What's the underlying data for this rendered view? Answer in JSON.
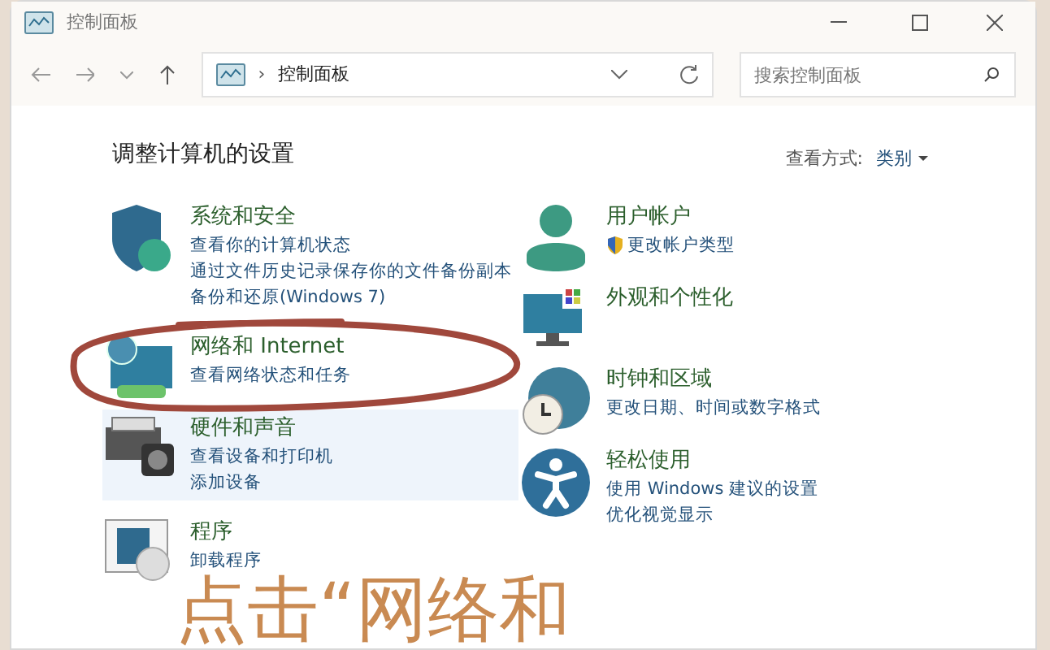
{
  "window": {
    "title": "控制面板"
  },
  "address_bar": {
    "separator": "›",
    "path": "控制面板"
  },
  "search": {
    "placeholder": "搜索控制面板"
  },
  "heading": "调整计算机的设置",
  "view_by": {
    "label": "查看方式:",
    "value": "类别"
  },
  "columns": [
    {
      "categories": [
        {
          "title": "系统和安全",
          "highlighted": false,
          "links": [
            {
              "text": "查看你的计算机状态",
              "shield": false
            },
            {
              "text": "通过文件历史记录保存你的文件备份副本",
              "shield": false
            },
            {
              "text": "备份和还原(Windows 7)",
              "shield": false
            }
          ]
        },
        {
          "title": "网络和 Internet",
          "highlighted": false,
          "links": [
            {
              "text": "查看网络状态和任务",
              "shield": false
            }
          ]
        },
        {
          "title": "硬件和声音",
          "highlighted": true,
          "links": [
            {
              "text": "查看设备和打印机",
              "shield": false
            },
            {
              "text": "添加设备",
              "shield": false
            }
          ]
        },
        {
          "title": "程序",
          "highlighted": false,
          "links": [
            {
              "text": "卸载程序",
              "shield": false
            }
          ]
        }
      ]
    },
    {
      "categories": [
        {
          "title": "用户帐户",
          "highlighted": false,
          "links": [
            {
              "text": "更改帐户类型",
              "shield": true
            }
          ]
        },
        {
          "title": "外观和个性化",
          "highlighted": false
        },
        {
          "title": "时钟和区域",
          "highlighted": false,
          "links": [
            {
              "text": "更改日期、时间或数字格式",
              "shield": false
            }
          ]
        },
        {
          "title": "轻松使用",
          "highlighted": false,
          "links": [
            {
              "text": "使用 Windows 建议的设置",
              "shield": false
            },
            {
              "text": "优化视觉显示",
              "shield": false
            }
          ]
        }
      ]
    }
  ],
  "annotation": {
    "caption": "点击“网络和"
  }
}
